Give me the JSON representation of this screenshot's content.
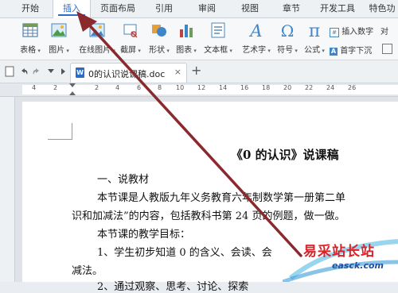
{
  "menu": {
    "tabs": [
      {
        "label": "开始"
      },
      {
        "label": "插入"
      },
      {
        "label": "页面布局"
      },
      {
        "label": "引用"
      },
      {
        "label": "审阅"
      },
      {
        "label": "视图"
      },
      {
        "label": "章节"
      },
      {
        "label": "开发工具"
      },
      {
        "label": "特色功"
      }
    ]
  },
  "ribbon": {
    "buttons": [
      {
        "label": "表格",
        "icon": "table-icon"
      },
      {
        "label": "图片",
        "icon": "picture-icon"
      },
      {
        "label": "在线图片",
        "icon": "online-picture-icon"
      },
      {
        "label": "截屏",
        "icon": "screenshot-icon"
      },
      {
        "label": "形状",
        "icon": "shapes-icon"
      },
      {
        "label": "图表",
        "icon": "chart-icon"
      },
      {
        "label": "文本框",
        "icon": "textbox-icon"
      },
      {
        "label": "艺术字",
        "icon": "wordart-icon"
      },
      {
        "label": "符号",
        "icon": "symbol-icon"
      },
      {
        "label": "公式",
        "icon": "formula-icon"
      }
    ],
    "insert_number": "插入数字",
    "first_char_sink": "首字下沉",
    "object_partial": "对"
  },
  "toolbar": {
    "doc_tab_title": "0的认识说课稿.doc",
    "close_glyph": "×",
    "new_tab_glyph": "+"
  },
  "ruler": {
    "numbers": [
      "4",
      "2",
      "2",
      "4",
      "6",
      "8",
      "10",
      "12",
      "14",
      "16",
      "18",
      "20",
      "22",
      "24",
      "26"
    ]
  },
  "document": {
    "title": "《0 的认识》说课稿",
    "lines": [
      "一、说教材",
      "本节课是人教版九年义务教育六年制数学第一册第二单",
      "识和加减法”的内容，包括教科书第 24 页的例题，做一做。",
      "本节课的教学目标：",
      "1、学生初步知道 0 的含义、会读、会",
      "减法。",
      "2、通过观察、思考、讨论、探索"
    ]
  },
  "watermark": {
    "text": "易采站长站",
    "url": "easck.com"
  },
  "colors": {
    "accent": "#2b6cc4",
    "arrow": "#8b2a2e",
    "watermark_red": "#d8232a",
    "watermark_blue": "#1e4fa0"
  }
}
